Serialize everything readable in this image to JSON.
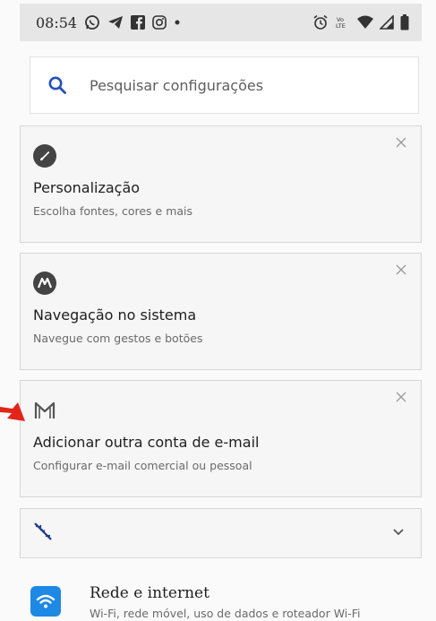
{
  "status_bar": {
    "time": "08:54",
    "notification_icons": [
      "whatsapp-icon",
      "telegram-icon",
      "facebook-icon",
      "instagram-icon",
      "dot-icon"
    ],
    "system_icons": [
      "alarm-icon",
      "volte-icon",
      "wifi-icon",
      "signal-icon",
      "battery-icon"
    ]
  },
  "search": {
    "placeholder": "Pesquisar configurações"
  },
  "suggestions": [
    {
      "icon": "brush-icon",
      "title": "Personalização",
      "subtitle": "Escolha fontes, cores e mais"
    },
    {
      "icon": "motorola-icon",
      "title": "Navegação no sistema",
      "subtitle": "Navegue com gestos e botões"
    },
    {
      "icon": "gmail-icon",
      "title": "Adicionar outra conta de e-mail",
      "subtitle": "Configurar e-mail comercial ou pessoal"
    }
  ],
  "collapsed_suggestions": {
    "icon": "signal-off-icon",
    "expand_icon": "chevron-down-icon"
  },
  "settings": [
    {
      "icon": "wifi-icon",
      "title": "Rede e internet",
      "subtitle": "Wi-Fi, rede móvel, uso de dados e roteador Wi-Fi"
    }
  ],
  "colors": {
    "accent": "#1e88e5",
    "search_icon": "#2450b8",
    "annotation_arrow": "#e3241b"
  }
}
